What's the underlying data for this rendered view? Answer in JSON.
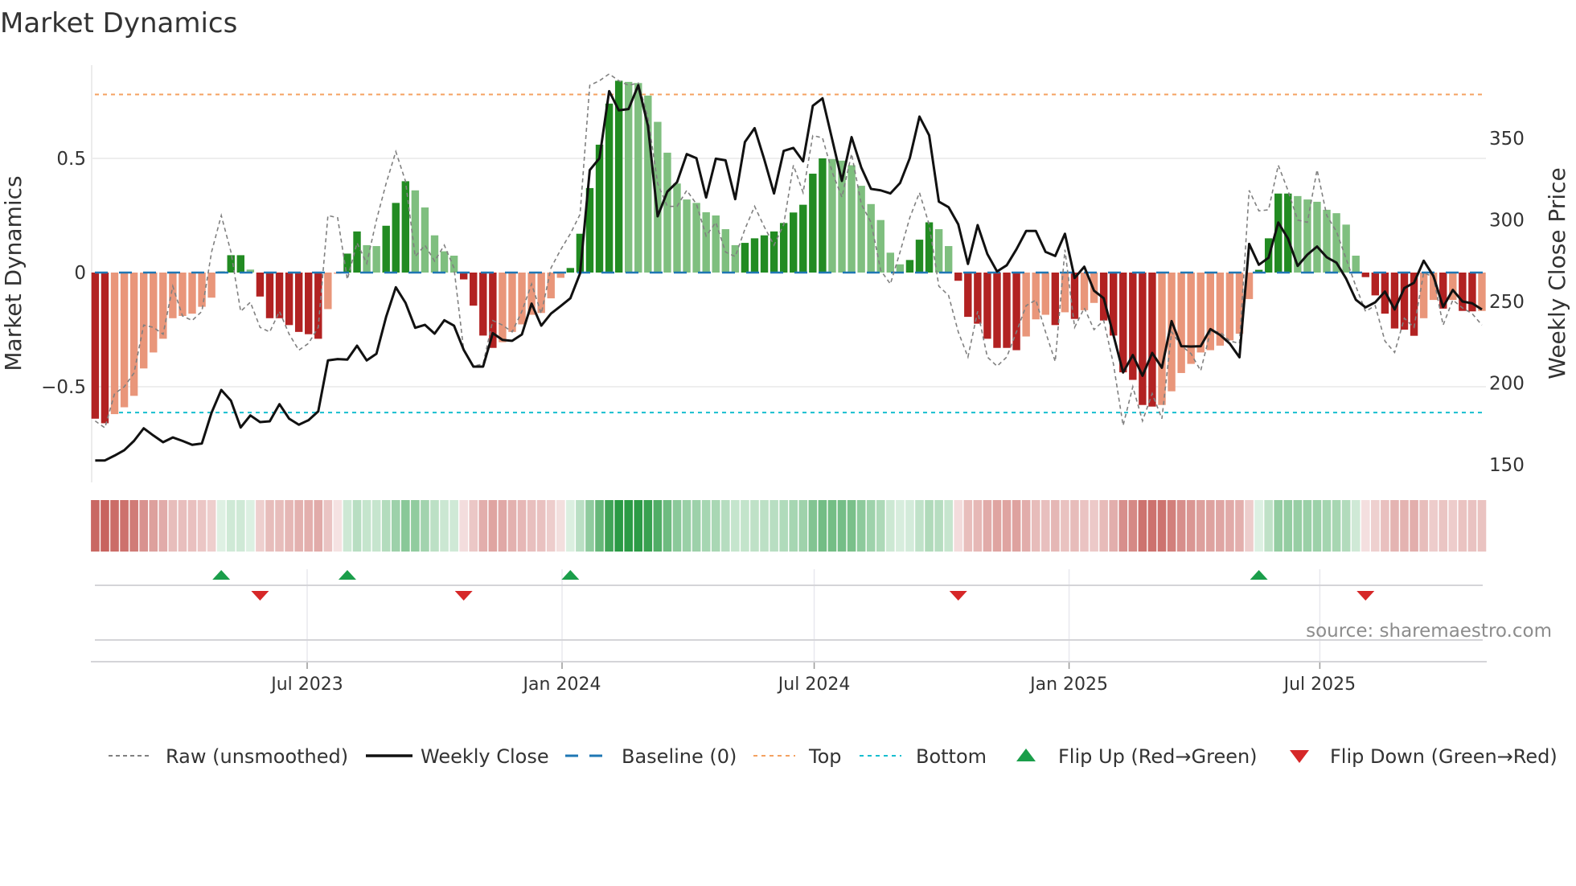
{
  "chart_data": {
    "type": "bar",
    "title": "Market Dynamics",
    "ylabel_left": "Market Dynamics",
    "ylabel_right": "Weekly Close Price",
    "x_start": "2023-01-29",
    "x_freq": "weekly",
    "ylim_left": [
      -0.83,
      0.95
    ],
    "ylim_right": [
      143,
      380
    ],
    "yticks_left": [
      {
        "value": 0.5,
        "label": "0.5"
      },
      {
        "value": 0,
        "label": "0"
      },
      {
        "value": -0.5,
        "label": "−0.5"
      }
    ],
    "yticks_right": [
      {
        "value": 350,
        "label": "350"
      },
      {
        "value": 300,
        "label": "300"
      },
      {
        "value": 250,
        "label": "250"
      },
      {
        "value": 200,
        "label": "200"
      },
      {
        "value": 150,
        "label": "150"
      }
    ],
    "xticks": [
      {
        "date": "2023-07-01",
        "label": "Jul 2023"
      },
      {
        "date": "2024-01-01",
        "label": "Jan 2024"
      },
      {
        "date": "2024-07-01",
        "label": "Jul 2024"
      },
      {
        "date": "2025-01-01",
        "label": "Jan 2025"
      },
      {
        "date": "2025-07-01",
        "label": "Jul 2025"
      }
    ],
    "top_level": 0.78,
    "bottom_level": -0.613,
    "baseline": 0,
    "grid": true,
    "legend_placement": "bottom",
    "series": [
      {
        "name": "Market Dynamics (smoothed)",
        "kind": "bar",
        "values": [
          -0.64,
          -0.66,
          -0.62,
          -0.59,
          -0.54,
          -0.42,
          -0.35,
          -0.29,
          -0.2,
          -0.19,
          -0.18,
          -0.15,
          -0.11,
          0.005,
          0.076,
          0.076,
          0.013,
          -0.105,
          -0.2,
          -0.2,
          -0.23,
          -0.26,
          -0.27,
          -0.29,
          -0.16,
          -0.005,
          0.083,
          0.18,
          0.12,
          0.116,
          0.205,
          0.305,
          0.4,
          0.36,
          0.285,
          0.163,
          0.093,
          0.074,
          -0.03,
          -0.145,
          -0.276,
          -0.33,
          -0.305,
          -0.26,
          -0.227,
          -0.185,
          -0.177,
          -0.113,
          -0.023,
          0.02,
          0.17,
          0.37,
          0.56,
          0.74,
          0.84,
          0.835,
          0.83,
          0.775,
          0.66,
          0.525,
          0.39,
          0.32,
          0.305,
          0.264,
          0.25,
          0.19,
          0.12,
          0.13,
          0.15,
          0.163,
          0.18,
          0.217,
          0.263,
          0.297,
          0.433,
          0.5,
          0.497,
          0.49,
          0.47,
          0.38,
          0.3,
          0.23,
          0.087,
          0.036,
          0.055,
          0.144,
          0.22,
          0.19,
          0.116,
          -0.036,
          -0.194,
          -0.224,
          -0.29,
          -0.33,
          -0.33,
          -0.34,
          -0.28,
          -0.205,
          -0.185,
          -0.23,
          -0.174,
          -0.203,
          -0.165,
          -0.133,
          -0.21,
          -0.276,
          -0.437,
          -0.47,
          -0.58,
          -0.587,
          -0.58,
          -0.52,
          -0.44,
          -0.4,
          -0.35,
          -0.34,
          -0.32,
          -0.297,
          -0.268,
          -0.116,
          0.012,
          0.15,
          0.346,
          0.346,
          0.335,
          0.32,
          0.31,
          0.275,
          0.26,
          0.21,
          0.074,
          -0.02,
          -0.1,
          -0.18,
          -0.245,
          -0.25,
          -0.277,
          -0.2,
          -0.12,
          -0.158,
          -0.12,
          -0.168,
          -0.17,
          -0.168
        ]
      },
      {
        "name": "Raw (unsmoothed)",
        "kind": "line",
        "values": [
          -0.65,
          -0.68,
          -0.53,
          -0.5,
          -0.44,
          -0.23,
          -0.24,
          -0.27,
          -0.06,
          -0.19,
          -0.21,
          -0.17,
          0.09,
          0.25,
          0.09,
          -0.17,
          -0.13,
          -0.24,
          -0.26,
          -0.17,
          -0.27,
          -0.34,
          -0.31,
          -0.24,
          0.25,
          0.24,
          -0.03,
          0.13,
          0.04,
          0.23,
          0.39,
          0.53,
          0.4,
          0.07,
          0.12,
          0.05,
          0.12,
          0.02,
          -0.34,
          -0.41,
          -0.4,
          -0.21,
          -0.23,
          -0.26,
          -0.17,
          -0.05,
          -0.18,
          0.02,
          0.1,
          0.17,
          0.255,
          0.82,
          0.84,
          0.87,
          0.84,
          0.82,
          0.83,
          0.68,
          0.39,
          0.29,
          0.29,
          0.36,
          0.3,
          0.16,
          0.22,
          0.09,
          0.07,
          0.19,
          0.29,
          0.2,
          0.12,
          0.21,
          0.47,
          0.35,
          0.6,
          0.59,
          0.44,
          0.33,
          0.52,
          0.3,
          0.22,
          0.01,
          -0.05,
          0.09,
          0.24,
          0.35,
          0.21,
          -0.06,
          -0.1,
          -0.26,
          -0.37,
          -0.17,
          -0.37,
          -0.41,
          -0.37,
          -0.26,
          -0.145,
          -0.12,
          -0.26,
          -0.39,
          0.1,
          -0.24,
          -0.155,
          -0.25,
          -0.21,
          -0.4,
          -0.67,
          -0.5,
          -0.65,
          -0.53,
          -0.64,
          -0.26,
          -0.32,
          -0.355,
          -0.43,
          -0.26,
          -0.26,
          -0.3,
          -0.31,
          0.36,
          0.27,
          0.275,
          0.47,
          0.36,
          0.23,
          0.22,
          0.45,
          0.25,
          0.18,
          0.06,
          -0.06,
          -0.17,
          -0.145,
          -0.3,
          -0.35,
          -0.2,
          -0.24,
          0.0,
          -0.02,
          -0.23,
          -0.12,
          -0.155,
          -0.18,
          -0.23
        ]
      },
      {
        "name": "Weekly Close",
        "kind": "line",
        "axis": "right",
        "values": [
          152.6,
          152.6,
          155.6,
          158.9,
          164.6,
          172.3,
          167.9,
          163.8,
          166.7,
          164.6,
          162.2,
          163,
          181.9,
          195.8,
          189.2,
          172.8,
          180.2,
          176.1,
          176.6,
          187.1,
          178.2,
          174.5,
          177.3,
          182.7,
          213.9,
          214.7,
          214.4,
          222.9,
          213.9,
          218,
          240.6,
          258.7,
          249.2,
          233.9,
          235.7,
          230.3,
          238.5,
          235.2,
          220.4,
          210.1,
          210.1,
          230.6,
          226.5,
          225.9,
          229.8,
          248.7,
          235.2,
          242.6,
          247.2,
          252,
          267.2,
          330.5,
          337.8,
          378.9,
          367.1,
          367.9,
          382.5,
          357.6,
          302.2,
          317.3,
          323.1,
          340.3,
          337.8,
          313.7,
          337.5,
          336.5,
          312.7,
          347.7,
          356.2,
          337,
          316.2,
          342.3,
          344.1,
          335.9,
          369.9,
          374.5,
          349.3,
          323.9,
          350.7,
          332.1,
          319,
          318.1,
          316.2,
          322.6,
          337.8,
          363.3,
          351.8,
          311.2,
          307.8,
          297.3,
          273,
          296.8,
          279.1,
          268.4,
          272.2,
          282,
          293.2,
          293.2,
          280.4,
          277.9,
          291.5,
          264.4,
          271.3,
          256.6,
          252,
          229.5,
          206.5,
          217.2,
          204.5,
          218.5,
          209.4,
          238,
          222.6,
          222.4,
          222.6,
          233.1,
          229.5,
          224.2,
          215.8,
          285.3,
          272.5,
          276.8,
          298.4,
          288.6,
          271.8,
          278.7,
          283.7,
          277.1,
          273.8,
          264,
          251.1,
          246.4,
          249.5,
          256.1,
          245.1,
          258.2,
          261.5,
          275,
          265.6,
          246.7,
          257.1,
          250,
          248.9,
          245.1
        ]
      }
    ],
    "flips_up_index": [
      13,
      26,
      49,
      120
    ],
    "flips_down_index": [
      17,
      38,
      89,
      131
    ],
    "legend": [
      {
        "label": "Raw (unsmoothed)",
        "icon": "dashed-gray-line"
      },
      {
        "label": "Weekly Close",
        "icon": "solid-black-line"
      },
      {
        "label": "Baseline (0)",
        "icon": "dashed-blue-line"
      },
      {
        "label": "Top",
        "icon": "dotted-orange-line"
      },
      {
        "label": "Bottom",
        "icon": "dotted-cyan-line"
      },
      {
        "label": "Flip Up (Red→Green)",
        "icon": "triangle-up-icon"
      },
      {
        "label": "Flip Down (Green→Red)",
        "icon": "triangle-down-icon"
      }
    ],
    "source": "source: sharemaestro.com"
  },
  "colors": {
    "dark_red": "#b22222",
    "light_red": "#e9967a",
    "dark_green": "#228b22",
    "light_green": "#7fbf7f",
    "baseline": "#1f77b4",
    "top": "#f4a261",
    "bottom": "#17becf",
    "flip_up": "#1a9e4a",
    "flip_down": "#d62728",
    "raw": "#808080",
    "close": "#111111"
  }
}
